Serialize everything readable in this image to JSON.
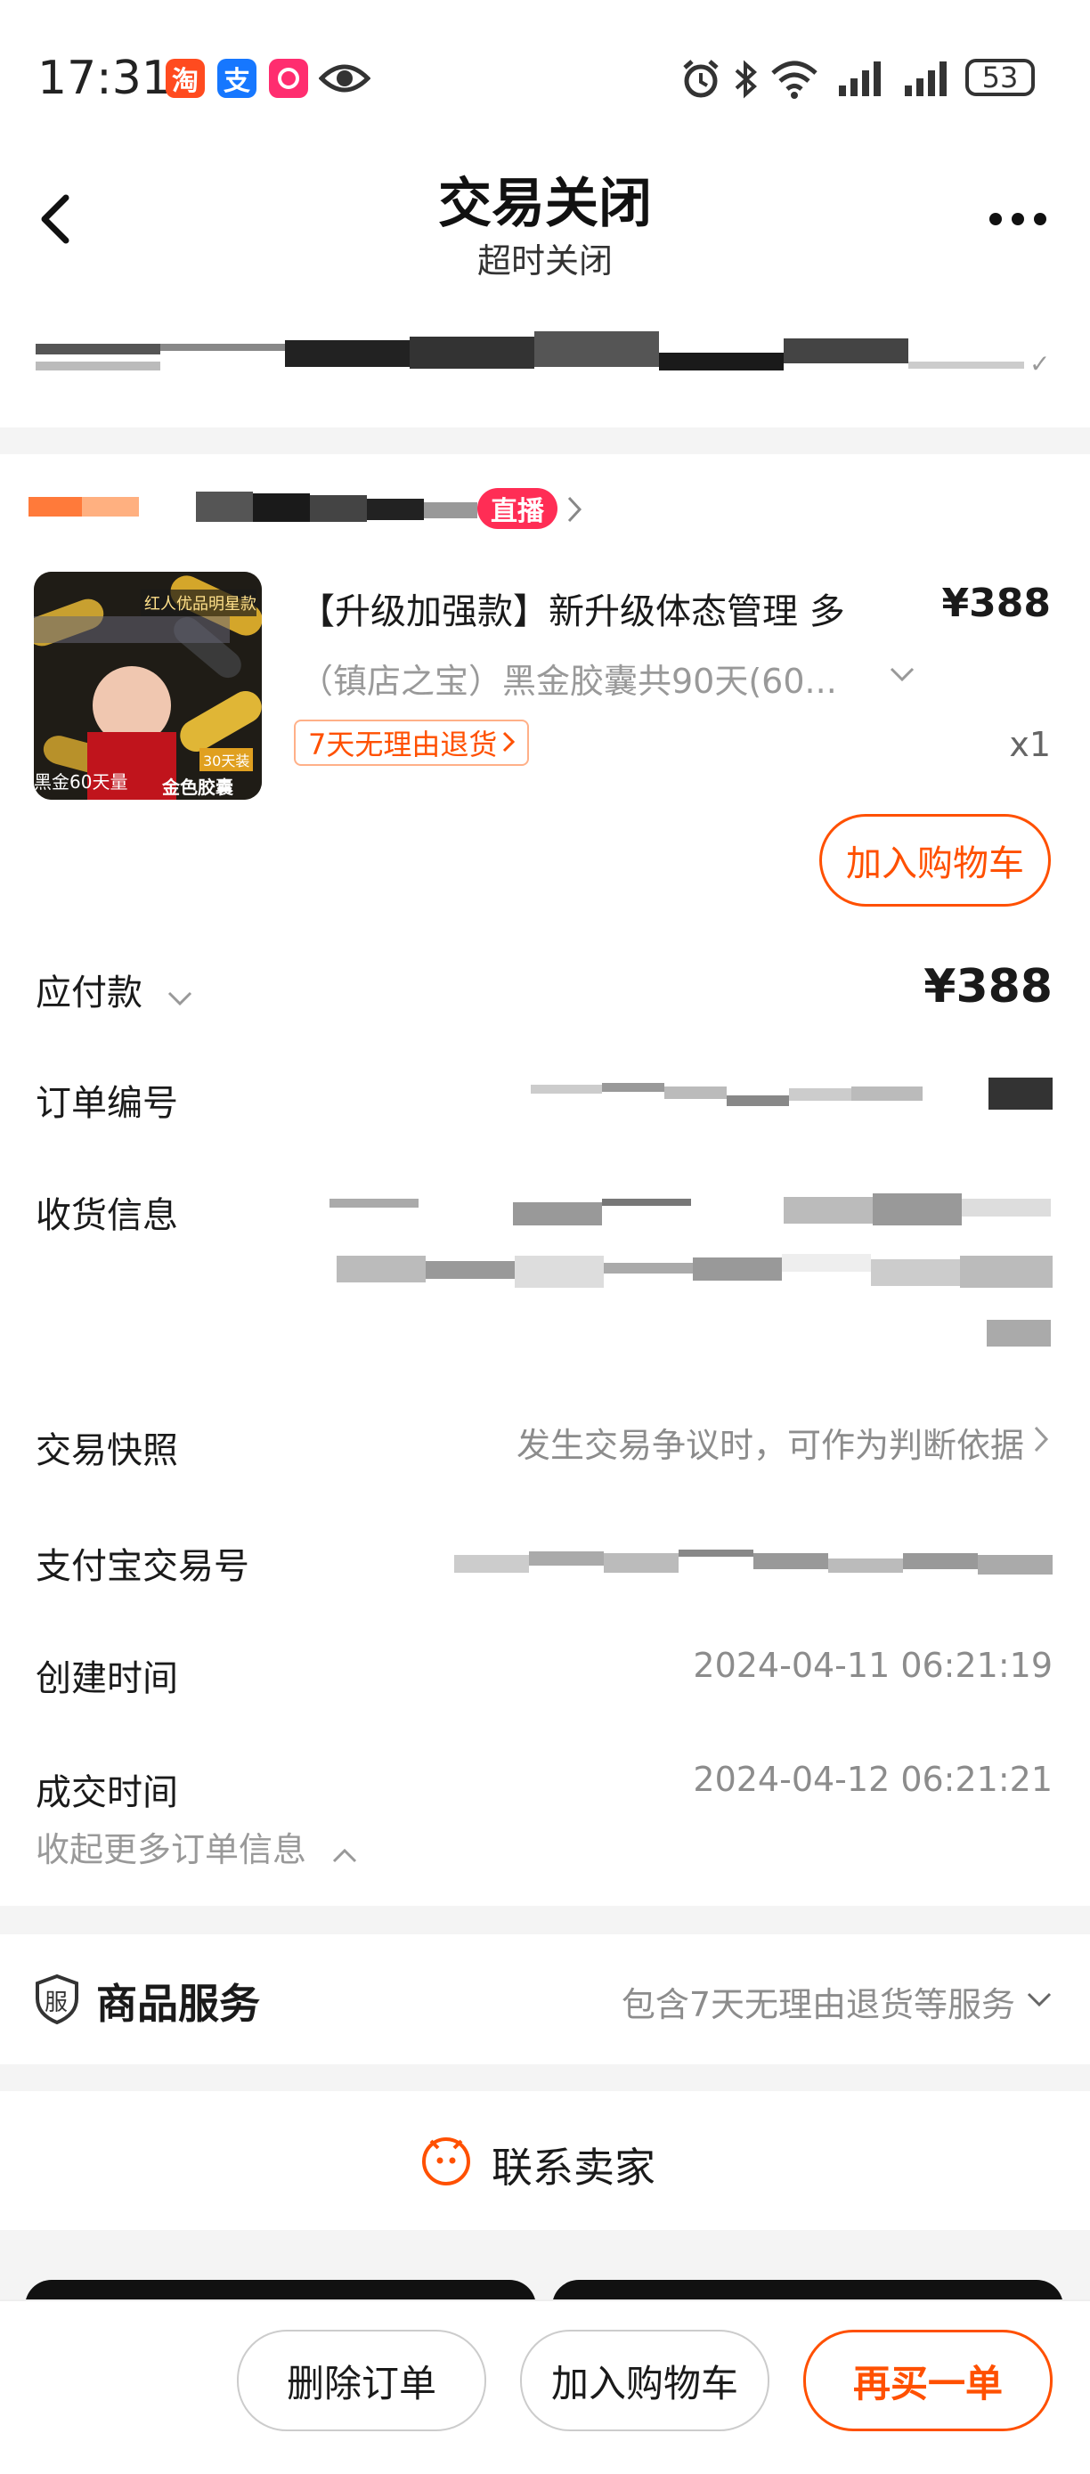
{
  "status_bar": {
    "time": "17:31",
    "battery": "53",
    "app_icons": [
      "淘",
      "支"
    ]
  },
  "header": {
    "title": "交易关闭",
    "subtitle": "超时关闭"
  },
  "shop": {
    "live_badge": "直播"
  },
  "product": {
    "image_top_label": "红人优品明星款",
    "image_bottom_left": "黑金60天量",
    "image_bottom_right": "金色胶囊",
    "image_badge": "30天装",
    "title": "【升级加强款】新升级体态管理 多",
    "price": "¥388",
    "spec": "（镇店之宝）黑金胶囊共90天(60...",
    "return_tag": "7天无理由退货",
    "quantity": "x1",
    "add_to_cart_label": "加入购物车"
  },
  "order_info": {
    "payable_label": "应付款",
    "payable_value": "¥388",
    "order_no_label": "订单编号",
    "address_label": "收货信息",
    "snapshot_label": "交易快照",
    "snapshot_value": "发生交易争议时，可作为判断依据",
    "alipay_label": "支付宝交易号",
    "created_label": "创建时间",
    "created_value": "2024-04-11 06:21:19",
    "deal_label": "成交时间",
    "deal_value": "2024-04-12 06:21:21",
    "collapse_label": "收起更多订单信息"
  },
  "service": {
    "icon_text": "服",
    "label": "商品服务",
    "value": "包含7天无理由退货等服务"
  },
  "contact": {
    "label": "联系卖家"
  },
  "bottom_bar": {
    "delete_label": "删除订单",
    "cart_label": "加入购物车",
    "rebuy_label": "再买一单"
  },
  "colors": {
    "accent": "#ff5000",
    "live": "#ff2d55"
  }
}
